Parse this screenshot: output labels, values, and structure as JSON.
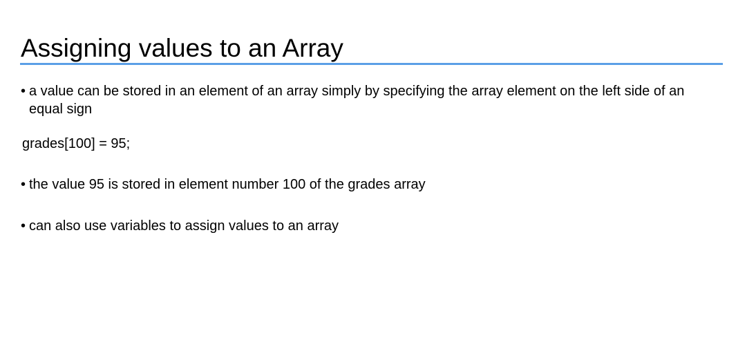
{
  "slide": {
    "title": "Assigning values to an Array",
    "bullet_glyph": "•",
    "bullet1": "a value can be stored in an element of an array simply by specifying the array element on the left side of an equal sign",
    "code": "grades[100] = 95;",
    "bullet2": "the value 95 is stored in element number 100 of the grades array",
    "bullet3": "can also use variables to assign values to an array"
  },
  "colors": {
    "title_rule": "#5b9fe6",
    "text": "#000000",
    "background": "#ffffff"
  }
}
